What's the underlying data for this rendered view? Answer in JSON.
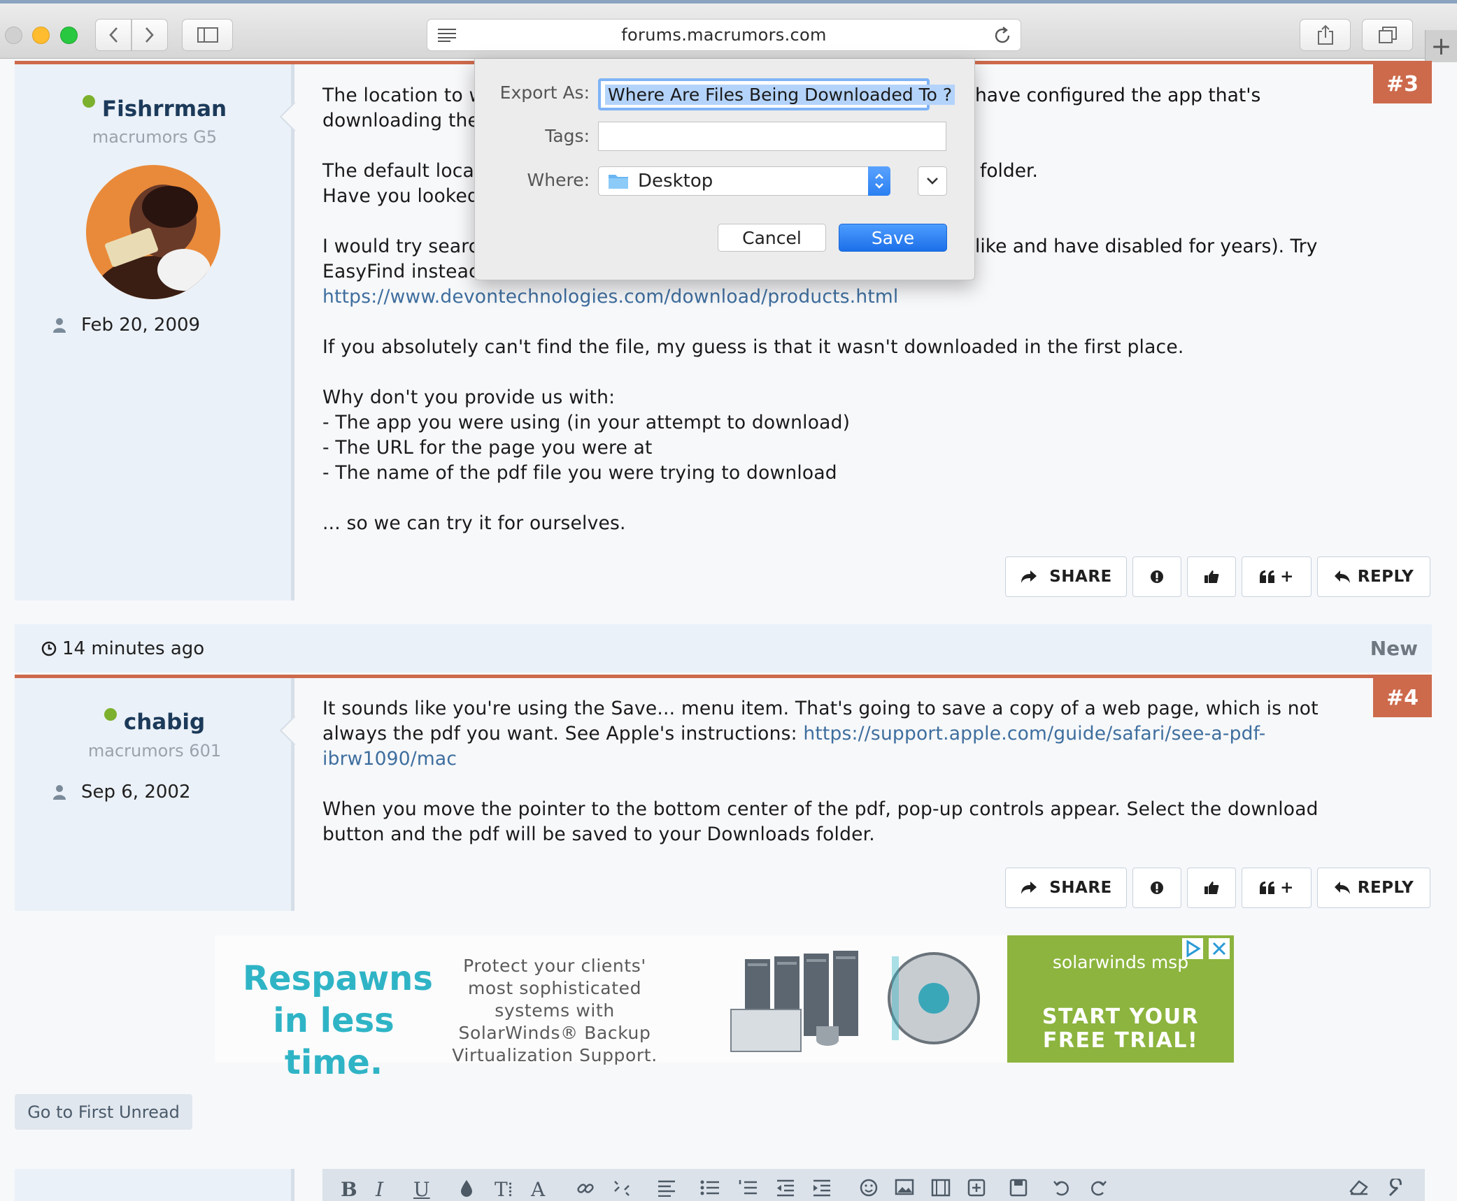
{
  "browser": {
    "url": "forums.macrumors.com"
  },
  "dialog": {
    "export_label": "Export As:",
    "export_value": "Where Are Files Being Downloaded To ?",
    "tags_label": "Tags:",
    "tags_value": "",
    "where_label": "Where:",
    "where_value": "Desktop",
    "cancel_label": "Cancel",
    "save_label": "Save",
    "accent": "#1c6fe8"
  },
  "post3": {
    "number": "#3",
    "username": "Fishrrman",
    "user_title": "macrumors G5",
    "joined": "Feb 20, 2009",
    "paragraphs": [
      "The location to w",
      "downloading the",
      "The default locat",
      "Have you looked",
      "I would try searc",
      "EasyFind instead"
    ],
    "right_fragments": [
      "have configured the app that's",
      "folder.",
      "like and have disabled for years). Try"
    ],
    "link": "https://www.devontechnologies.com/download/products.html",
    "p_absolutely": "If you absolutely can't find the file, my guess is that it wasn't downloaded in the first place.",
    "p_why": "Why don't you provide us with:",
    "bullets": [
      "- The app you were using (in your attempt to download)",
      "- The URL for the page you were at",
      "- The name of the pdf file you were trying to download"
    ],
    "p_end": "... so we can try it for ourselves."
  },
  "meta": {
    "time": "14 minutes ago",
    "new_label": "New"
  },
  "post4": {
    "number": "#4",
    "username": "chabig",
    "user_title": "macrumors 601",
    "joined": "Sep 6, 2002",
    "p1_text": "It sounds like you're using the Save... menu item. That's going to save a copy of a web page, which is not always the pdf you want. See Apple's instructions: ",
    "p1_link": "https://support.apple.com/guide/safari/see-a-pdf-ibrw1090/mac",
    "p2": "When you move the pointer to the bottom center of the pdf, pop-up controls appear. Select the download button and the pdf will be saved to your Downloads folder."
  },
  "actions": {
    "share": "SHARE",
    "reply": "REPLY",
    "quote_plus": "+"
  },
  "ad": {
    "headline": "Respawns in less time.",
    "copy": "Protect your clients' most sophisticated systems with SolarWinds® Backup Virtualization Support.",
    "brand": "solarwinds msp",
    "cta": "START YOUR FREE TRIAL!"
  },
  "first_unread": "Go to First Unread",
  "colors": {
    "post_accent": "#cd6a4c",
    "online": "#7cb12e",
    "link": "#3e6e9e",
    "ad_green": "#8cb43e"
  }
}
